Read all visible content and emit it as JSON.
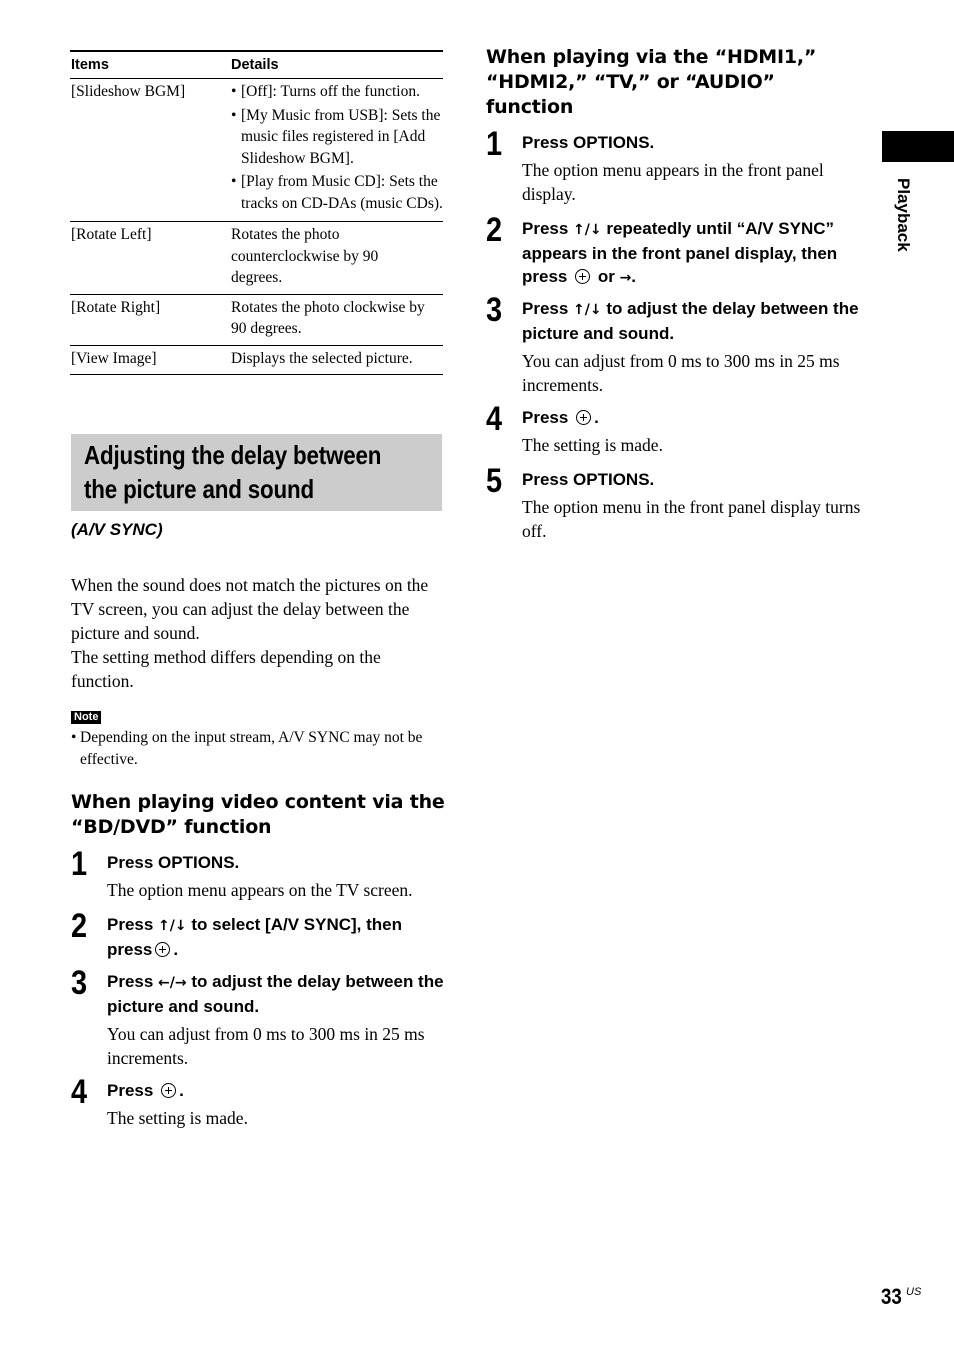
{
  "table": {
    "headers": [
      "Items",
      "Details"
    ],
    "rows": [
      {
        "item": "[Slideshow BGM]",
        "bullets": [
          "[Off]: Turns off the function.",
          "[My Music from USB]: Sets the music files registered in [Add Slideshow BGM].",
          "[Play from Music CD]: Sets the tracks on CD-DAs (music CDs)."
        ]
      },
      {
        "item": "[Rotate Left]",
        "detail": "Rotates the photo counterclockwise by 90 degrees."
      },
      {
        "item": "[Rotate Right]",
        "detail": "Rotates the photo clockwise by 90 degrees."
      },
      {
        "item": "[View Image]",
        "detail": "Displays the selected picture."
      }
    ]
  },
  "section": {
    "title_line1": "Adjusting the delay between",
    "title_line2": "the picture and sound",
    "subtitle": "(A/V SYNC)",
    "intro_line1": "When the sound does not match the pictures on the TV screen, you can adjust the delay between the picture and sound.",
    "intro_line2": "The setting method differs depending on the function.",
    "note_label": "Note",
    "note_text": "Depending on the input stream, A/V SYNC may not be effective."
  },
  "bd_dvd": {
    "heading": "When playing video content via the “BD/DVD” function",
    "steps": [
      {
        "num": "1",
        "instr": "Press OPTIONS.",
        "desc": "The option menu appears on the TV screen."
      },
      {
        "num": "2",
        "instr_pre": "Press ",
        "arrows": "↑/↓",
        "instr_mid": " to select [A/V SYNC], then press",
        "instr_post": "."
      },
      {
        "num": "3",
        "instr_pre": "Press ",
        "arrows": "←/→",
        "instr_mid": " to adjust the delay between the picture and sound.",
        "desc": "You can adjust from 0 ms to 300 ms in 25 ms increments."
      },
      {
        "num": "4",
        "instr_pre": "Press",
        "instr_post": ".",
        "desc": "The setting is made."
      }
    ]
  },
  "hdmi": {
    "heading": "When playing via the “HDMI1,” “HDMI2,” “TV,” or “AUDIO” function",
    "steps": [
      {
        "num": "1",
        "instr": "Press OPTIONS.",
        "desc": "The option menu appears in the front panel display."
      },
      {
        "num": "2",
        "instr_pre": "Press ",
        "arrows": "↑/↓",
        "instr_mid": " repeatedly until “A/V SYNC” appears in the front panel display, then press",
        "instr_or": " or ",
        "arrow_right": "→",
        "instr_post": "."
      },
      {
        "num": "3",
        "instr_pre": "Press ",
        "arrows": "↑/↓",
        "instr_mid": " to adjust the delay between the picture and sound.",
        "desc": "You can adjust from 0 ms to 300 ms in 25 ms increments."
      },
      {
        "num": "4",
        "instr_pre": "Press",
        "instr_post": ".",
        "desc": "The setting is made."
      },
      {
        "num": "5",
        "instr": "Press OPTIONS.",
        "desc": "The option menu in the front panel display turns off."
      }
    ]
  },
  "side_tab": {
    "label": "Playback"
  },
  "footer": {
    "page_number": "33",
    "region": "US"
  }
}
